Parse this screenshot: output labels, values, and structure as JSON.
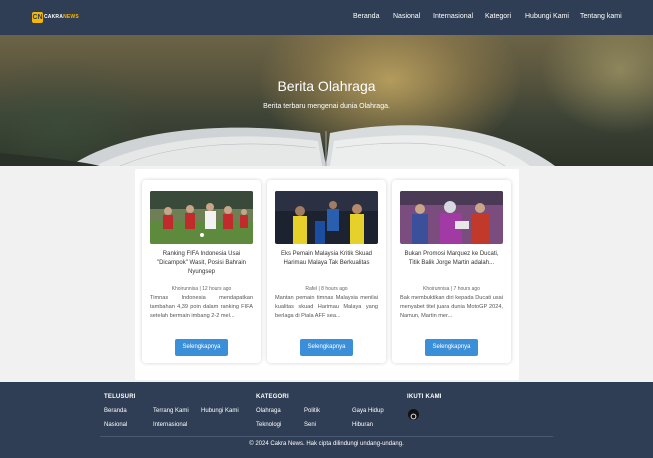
{
  "brand": {
    "logo_mark": "CN",
    "logo_word_a": "CAKRA",
    "logo_word_b": "NEWS",
    "accent": "#f5b800"
  },
  "nav": {
    "items": [
      "Beranda",
      "Nasional",
      "Internasional",
      "Kategori",
      "Hubungi Kami",
      "Tentang kami"
    ]
  },
  "hero": {
    "title": "Berita Olahraga",
    "subtitle": "Berita terbaru mengenai dunia Olahraga."
  },
  "cards": [
    {
      "title": "Ranking FIFA Indonesia Usai \"Dicampok\" Wasit, Posisi Bahrain Nyungsep",
      "meta": "Khoirunnisa | 12 hours ago",
      "excerpt": "Timnas Indonesia mendapatkan tambahan 4,39 poin dalam ranking FIFA setelah bermain imbang 2-2 mel...",
      "button": "Selengkapnya"
    },
    {
      "title": "Eks Pemain Malaysia Kritik Skuad Harimau Malaya Tak Berkualitas",
      "meta": "Rafel | 8 hours ago",
      "excerpt": "Mantan pemain timnas Malaysia menilai kualitas skuad Harimau Malaya yang berlaga di Piala AFF sea...",
      "button": "Selengkapnya"
    },
    {
      "title": "Bukan Promosi Marquez ke Ducati, Titik Balik Jorge Martin adalah...",
      "meta": "Khoirunnisa | 7 hours ago",
      "excerpt": "Bak membuktikan diri kepada Ducati usai menyabet titel juara dunia MotoGP 2024, Namun, Martin mer...",
      "button": "Selengkapnya"
    }
  ],
  "footer": {
    "col1": {
      "heading": "TELUSURI",
      "links": [
        "Beranda",
        "Terrang Kami",
        "Hubungi Kami",
        "Nasional",
        "Internasional"
      ]
    },
    "col2": {
      "heading": "KATEGORI",
      "links": [
        "Olahraga",
        "Politik",
        "Gaya Hidup",
        "Teknologi",
        "Seni",
        "Hiburan"
      ]
    },
    "col3": {
      "heading": "IKUTI KAMI",
      "social_icon": "social-circle-icon"
    },
    "copyright": "© 2024 Cakra News. Hak cipta dilindungi undang-undang."
  },
  "colors": {
    "navbar": "#2f3e55",
    "button": "#3b8fd9",
    "page_bg": "#f1f1f1"
  }
}
